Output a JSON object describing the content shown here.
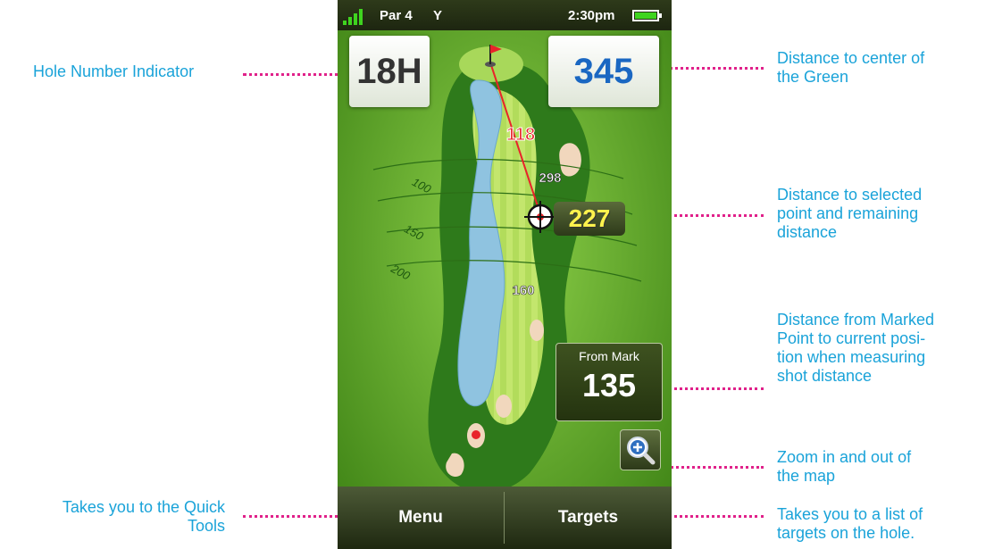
{
  "status_bar": {
    "par": "Par 4",
    "tee": "Y",
    "time": "2:30pm"
  },
  "hole_number": "18H",
  "distance_to_center": "345",
  "map": {
    "arc_labels": [
      "100",
      "150",
      "200"
    ],
    "distance_markers": [
      "118",
      "298",
      "160"
    ],
    "target_distance": "227"
  },
  "from_mark": {
    "label": "From Mark",
    "value": "135"
  },
  "bottom_bar": {
    "menu": "Menu",
    "targets": "Targets"
  },
  "callouts": {
    "hole_number": "Hole Number Indicator",
    "center_distance": [
      "Distance to center of",
      "the Green"
    ],
    "selected_point": [
      "Distance to selected",
      "point and remaining",
      "distance"
    ],
    "marked_point": [
      "Distance from Marked",
      "Point to current posi-",
      "tion when measuring",
      "shot distance"
    ],
    "zoom": [
      "Zoom in and out of",
      "the map"
    ],
    "quick_tools": [
      "Takes you to the Quick",
      "Tools"
    ],
    "targets_list": [
      "Takes you to a list of",
      "targets on the hole."
    ]
  },
  "colors": {
    "callout_text": "#1aa3d9",
    "leader_dots": "#e0218a",
    "center_distance": "#1a67c2",
    "target_distance": "#fff34d"
  },
  "icons": [
    "signal-icon",
    "battery-icon",
    "flag-icon",
    "crosshair-icon",
    "zoom-in-icon"
  ]
}
